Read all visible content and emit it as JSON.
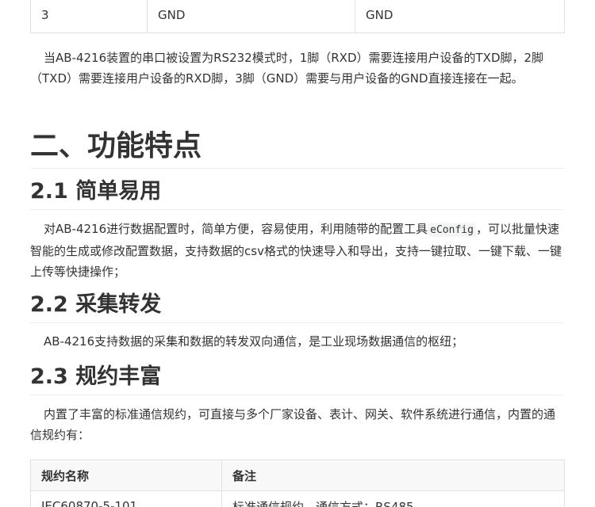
{
  "top_table": {
    "rows": [
      [
        "3",
        "GND",
        "GND"
      ]
    ]
  },
  "para_rs232": "当AB-4216装置的串口被设置为RS232模式时，1脚（RXD）需要连接用户设备的TXD脚，2脚（TXD）需要连接用户设备的RXD脚，3脚（GND）需要与用户设备的GND直接连接在一起。",
  "section2": {
    "title": "二、功能特点",
    "s21": {
      "title": "2.1 简单易用",
      "text_before": "对AB-4216进行数据配置时，简单方便，容易使用，利用随带的配置工具",
      "code": "eConfig",
      "text_after": "，可以批量快速智能的生成或修改配置数据，支持数据的csv格式的快速导入和导出，支持一键拉取、一键下载、一键上传等快捷操作；"
    },
    "s22": {
      "title": "2.2 采集转发",
      "text": "AB-4216支持数据的采集和数据的转发双向通信，是工业现场数据通信的枢纽；"
    },
    "s23": {
      "title": "2.3 规约丰富",
      "text": "内置了丰富的标准通信规约，可直接与多个厂家设备、表计、网关、软件系统进行通信，内置的通信规约有："
    }
  },
  "protocol_table": {
    "headers": [
      "规约名称",
      "备注"
    ],
    "rows": [
      [
        "IEC60870-5-101",
        "标准通信规约，通信方式：RS485"
      ]
    ]
  }
}
